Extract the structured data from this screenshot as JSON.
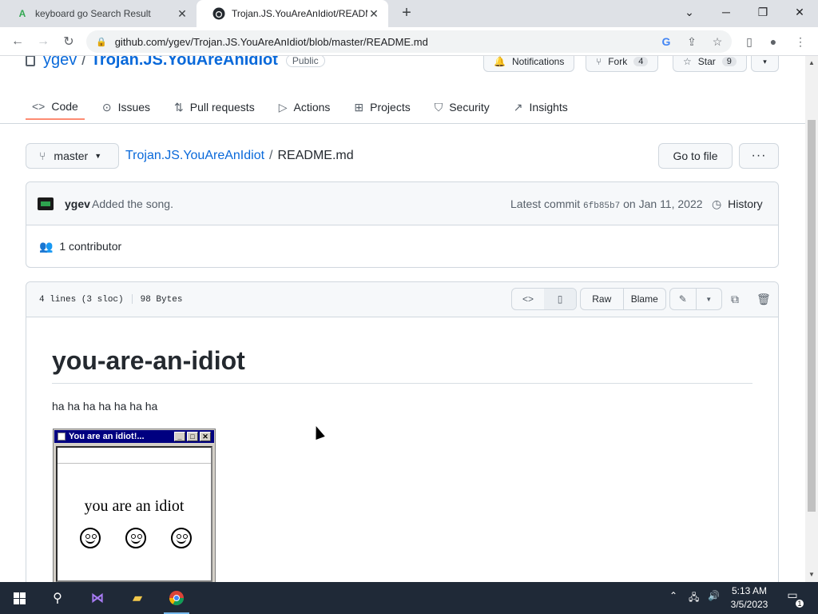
{
  "browser": {
    "tabs": [
      {
        "title": "keyboard go Search Result",
        "active": false
      },
      {
        "title": "Trojan.JS.YouAreAnIdiot/README",
        "active": true
      }
    ],
    "url": "github.com/ygev/Trojan.JS.YouAreAnIdiot/blob/master/README.md"
  },
  "repo": {
    "owner": "ygev",
    "name": "Trojan.JS.YouAreAnIdiot",
    "visibility": "Public",
    "notifications_label": "Notifications",
    "fork_label": "Fork",
    "fork_count": "4",
    "star_label": "Star",
    "star_count": "9"
  },
  "nav": {
    "code": "Code",
    "issues": "Issues",
    "pulls": "Pull requests",
    "actions": "Actions",
    "projects": "Projects",
    "security": "Security",
    "insights": "Insights"
  },
  "file": {
    "branch": "master",
    "repo_link": "Trojan.JS.YouAreAnIdiot",
    "filename": "README.md",
    "go_to_file": "Go to file",
    "more": "···"
  },
  "commit": {
    "author": "ygev",
    "message": "Added the song.",
    "latest_label": "Latest commit",
    "sha": "6fb85b7",
    "date": "on Jan 11, 2022",
    "history": "History",
    "contributors": "1 contributor"
  },
  "fileview": {
    "lines": "4 lines (3 sloc)",
    "size": "98 Bytes",
    "raw": "Raw",
    "blame": "Blame"
  },
  "readme": {
    "title": "you-are-an-idiot",
    "paragraph": "ha ha ha ha ha ha ha",
    "popup_title": "You are an idiot!...",
    "popup_text": "you are an idiot"
  },
  "taskbar": {
    "time": "5:13 AM",
    "date": "3/5/2023",
    "notifications": "1"
  }
}
